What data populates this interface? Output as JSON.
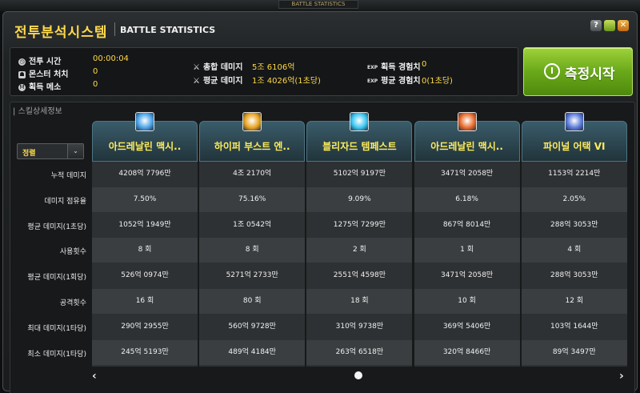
{
  "topbar": {
    "label": "BATTLE STATISTICS"
  },
  "window": {
    "title_ko": "전투분석시스템",
    "title_en": "BATTLE STATISTICS",
    "help_label": "?",
    "minimize_label": "",
    "close_label": "✕"
  },
  "summary": {
    "battle_time": {
      "label": "전투 시간",
      "value": "00:00:04"
    },
    "monsters": {
      "label": "몬스터 처치",
      "value": "0"
    },
    "mesos": {
      "label": "획득 메소",
      "value": "0"
    },
    "total_damage": {
      "label": "총합 데미지",
      "value": "5조 6106억"
    },
    "avg_damage": {
      "label": "평균 데미지",
      "value": "1조 4026억(1초당)"
    },
    "exp_gained": {
      "prefix": "EXP",
      "label": "획득 경험치",
      "value": "0"
    },
    "exp_avg": {
      "prefix": "EXP",
      "label": "평균 경험치",
      "value": "0(1초당)"
    }
  },
  "start_button": {
    "label": "측정시작"
  },
  "skill_section": {
    "title": "| 스킬상세정보"
  },
  "sort": {
    "value": "정렬",
    "arrow": "⌄"
  },
  "row_labels": [
    "누적 데미지",
    "데미지 점유율",
    "평균 데미지(1초당)",
    "사용횟수",
    "평균 데미지(1회당)",
    "공격횟수",
    "최대 데미지(1타당)",
    "최소 데미지(1타당)"
  ],
  "skills": [
    {
      "name": "아드레날린 맥시..",
      "icon": "wave-skill-icon",
      "icon_color": "#4aa3e8",
      "values": [
        "4208억 7796만",
        "7.50%",
        "1052억 1949만",
        "8 회",
        "526억 0974만",
        "16 회",
        "290억 2955만",
        "245억 5193만"
      ]
    },
    {
      "name": "하이퍼 부스트 엔..",
      "icon": "hyper-boost-skill-icon",
      "icon_color": "#e8a21c",
      "values": [
        "4조 2170억",
        "75.16%",
        "1조 0542억",
        "8 회",
        "5271억 2733만",
        "80 회",
        "560억 9728만",
        "489억 4184만"
      ]
    },
    {
      "name": "블리자드 템페스트",
      "icon": "blizzard-skill-icon",
      "icon_color": "#39c6f0",
      "values": [
        "5102억 9197만",
        "9.09%",
        "1275억 7299만",
        "2 회",
        "2551억 4598만",
        "18 회",
        "310억 9738만",
        "263억 6518만"
      ]
    },
    {
      "name": "아드레날린 맥시..",
      "icon": "fire-skill-icon",
      "icon_color": "#e86a2a",
      "values": [
        "3471억 2058만",
        "6.18%",
        "867억 8014만",
        "1 회",
        "3471억 2058만",
        "10 회",
        "369억 5406만",
        "320억 8466만"
      ]
    },
    {
      "name": "파이널 어택 VI",
      "icon": "final-attack-skill-icon",
      "icon_color": "#5a7ad8",
      "values": [
        "1153억 2214만",
        "2.05%",
        "288억 3053만",
        "4 회",
        "288억 3053만",
        "12 회",
        "103억 1644만",
        "89억 3497만"
      ]
    }
  ],
  "pager": {
    "prev": "‹",
    "next": "›"
  }
}
